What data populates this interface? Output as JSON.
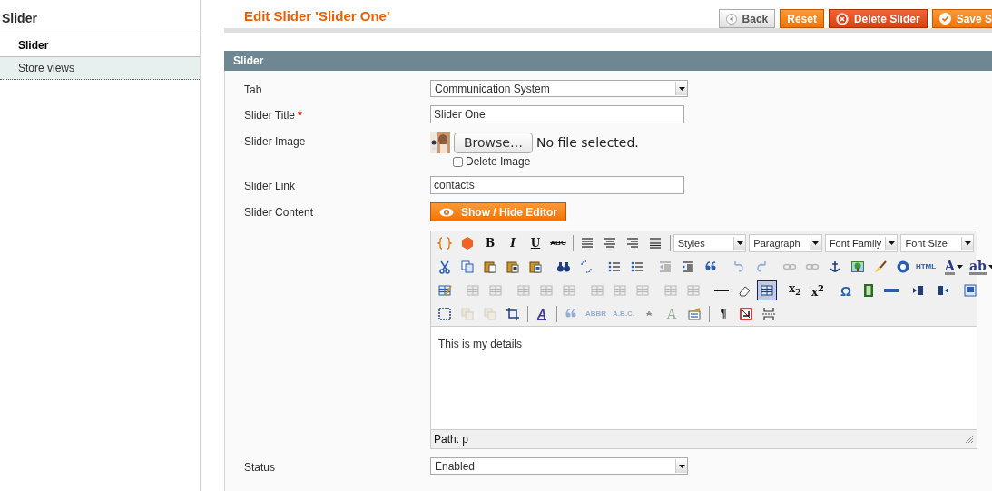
{
  "sidebar": {
    "title": "Slider",
    "tabs": [
      {
        "label": "Slider",
        "selected": true
      },
      {
        "label": "Store views",
        "selected": false
      }
    ]
  },
  "header": {
    "title": "Edit Slider 'Slider One'",
    "buttons": [
      {
        "kind": "back",
        "label": "Back"
      },
      {
        "kind": "reset",
        "label": "Reset"
      },
      {
        "kind": "delete",
        "label": "Delete Slider"
      },
      {
        "kind": "save",
        "label": "Save S"
      }
    ]
  },
  "section": {
    "title": "Slider",
    "fields": [
      {
        "kind": "select",
        "label": "Tab",
        "value": "Communication System"
      },
      {
        "kind": "text",
        "label": "Slider Title",
        "required_mark": "*",
        "value": "Slider One"
      },
      {
        "kind": "file",
        "label": "Slider Image",
        "browse": "Browse…",
        "status": "No file selected.",
        "delete_label": "Delete Image",
        "delete_checked": false
      },
      {
        "kind": "text",
        "label": "Slider Link",
        "value": "contacts"
      },
      {
        "kind": "editor",
        "label": "Slider Content",
        "toggle": "Show / Hide Editor",
        "content": "This is my details",
        "path": "Path: p",
        "toolbar": [
          [
            {
              "kind": "icon",
              "disabled": false
            },
            {
              "kind": "icon",
              "disabled": false
            },
            {
              "kind": "bold",
              "text": "B",
              "disabled": false
            },
            {
              "kind": "italic",
              "text": "I",
              "disabled": false
            },
            {
              "kind": "underline",
              "text": "U",
              "disabled": false
            },
            {
              "kind": "strike",
              "text": "ABC",
              "disabled": false
            },
            {
              "kind": "separator"
            },
            {
              "kind": "icon",
              "disabled": false
            },
            {
              "kind": "icon",
              "disabled": false
            },
            {
              "kind": "icon",
              "disabled": false
            },
            {
              "kind": "icon",
              "disabled": false
            },
            {
              "kind": "separator"
            },
            {
              "kind": "select",
              "label": "Styles"
            },
            {
              "kind": "select",
              "label": "Paragraph"
            },
            {
              "kind": "select",
              "label": "Font Family"
            },
            {
              "kind": "select",
              "label": "Font Size"
            }
          ],
          [
            {
              "kind": "icon",
              "disabled": false
            },
            {
              "kind": "icon",
              "disabled": false
            },
            {
              "kind": "icon",
              "disabled": false
            },
            {
              "kind": "icon",
              "disabled": false
            },
            {
              "kind": "icon",
              "disabled": false
            },
            {
              "kind": "separator"
            },
            {
              "kind": "icon",
              "disabled": false
            },
            {
              "kind": "icon",
              "disabled": false
            },
            {
              "kind": "separator"
            },
            {
              "kind": "icon",
              "disabled": false
            },
            {
              "kind": "icon",
              "disabled": false
            },
            {
              "kind": "separator"
            },
            {
              "kind": "icon",
              "disabled": true
            },
            {
              "kind": "icon",
              "disabled": false
            },
            {
              "kind": "icon",
              "disabled": false
            },
            {
              "kind": "separator"
            },
            {
              "kind": "icon",
              "disabled": true
            },
            {
              "kind": "icon",
              "disabled": true
            },
            {
              "kind": "separator"
            },
            {
              "kind": "icon",
              "disabled": true
            },
            {
              "kind": "icon",
              "disabled": true
            },
            {
              "kind": "icon",
              "disabled": false
            },
            {
              "kind": "icon",
              "disabled": false
            },
            {
              "kind": "icon",
              "disabled": false
            },
            {
              "kind": "icon",
              "disabled": false
            },
            {
              "kind": "small",
              "text": "HTML",
              "disabled": false
            },
            {
              "kind": "separator"
            },
            {
              "kind": "color",
              "text": "A"
            },
            {
              "kind": "color",
              "text": "ab"
            }
          ],
          [
            {
              "kind": "icon",
              "disabled": false
            },
            {
              "kind": "separator"
            },
            {
              "kind": "icon",
              "disabled": true
            },
            {
              "kind": "icon",
              "disabled": true
            },
            {
              "kind": "separator"
            },
            {
              "kind": "icon",
              "disabled": true
            },
            {
              "kind": "icon",
              "disabled": true
            },
            {
              "kind": "icon",
              "disabled": true
            },
            {
              "kind": "separator"
            },
            {
              "kind": "icon",
              "disabled": true
            },
            {
              "kind": "icon",
              "disabled": true
            },
            {
              "kind": "icon",
              "disabled": true
            },
            {
              "kind": "separator"
            },
            {
              "kind": "icon",
              "disabled": true
            },
            {
              "kind": "icon",
              "disabled": true
            },
            {
              "kind": "separator"
            },
            {
              "kind": "icon",
              "disabled": false
            },
            {
              "kind": "icon",
              "disabled": false
            },
            {
              "kind": "icon",
              "disabled": false,
              "active": true
            },
            {
              "kind": "separator"
            },
            {
              "kind": "bold",
              "text": "x$_{2}$",
              "disabled": false
            },
            {
              "kind": "bold",
              "text": "x$^{2}$",
              "disabled": false
            },
            {
              "kind": "separator"
            },
            {
              "kind": "blue",
              "text": "Ω",
              "disabled": false
            },
            {
              "kind": "icon",
              "disabled": false
            },
            {
              "kind": "icon",
              "disabled": false
            },
            {
              "kind": "separator"
            },
            {
              "kind": "icon",
              "disabled": false
            },
            {
              "kind": "icon",
              "disabled": false
            },
            {
              "kind": "separator"
            },
            {
              "kind": "icon",
              "disabled": false
            }
          ],
          [
            {
              "kind": "icon",
              "disabled": false
            },
            {
              "kind": "icon",
              "disabled": true
            },
            {
              "kind": "icon",
              "disabled": true
            },
            {
              "kind": "icon",
              "disabled": false
            },
            {
              "kind": "separator"
            },
            {
              "kind": "styled",
              "text": "A",
              "disabled": false
            },
            {
              "kind": "separator"
            },
            {
              "kind": "icon",
              "disabled": true
            },
            {
              "kind": "small",
              "text": "ABBR",
              "disabled": true
            },
            {
              "kind": "small",
              "text": "A.B.C.",
              "disabled": true
            },
            {
              "kind": "strike",
              "text": "A",
              "disabled": true
            },
            {
              "kind": "serif",
              "text": "A",
              "disabled": true
            },
            {
              "kind": "icon",
              "disabled": false
            },
            {
              "kind": "separator"
            },
            {
              "kind": "bold",
              "text": "¶",
              "disabled": false
            },
            {
              "kind": "icon",
              "disabled": false
            },
            {
              "kind": "icon",
              "disabled": false
            }
          ]
        ]
      },
      {
        "kind": "select",
        "label": "Status",
        "value": "Enabled"
      }
    ]
  }
}
